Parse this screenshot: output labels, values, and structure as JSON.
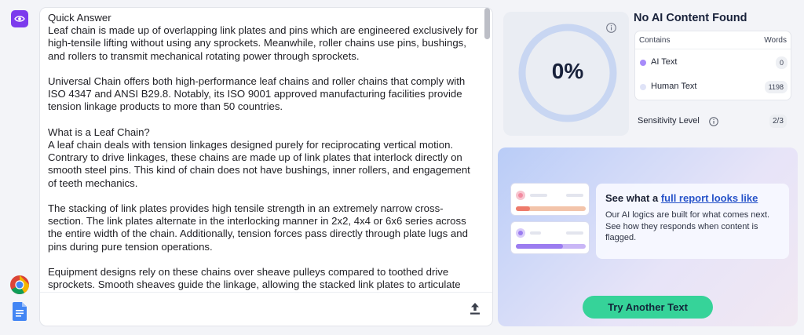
{
  "colors": {
    "accent_purple": "#7c3aed",
    "ring_blue": "#c8d6f2",
    "button_green": "#36d399",
    "ai_dot": "#a78bfa",
    "human_dot": "#dfe3f7",
    "link_blue": "#2753c9"
  },
  "rail": {
    "icons": [
      "eye-icon",
      "chrome-icon",
      "google-docs-icon"
    ]
  },
  "editor": {
    "paragraphs": [
      "Quick Answer\nLeaf chain is made up of overlapping link plates and pins which are engineered exclusively for high-tensile lifting without using any sprockets. Meanwhile, roller chains use pins, bushings, and rollers to transmit mechanical rotating power through sprockets.",
      "Universal Chain offers both high-performance leaf chains and roller chains that comply with ISO 4347 and ANSI B29.8. Notably, its ISO 9001 approved manufacturing facilities provide tension linkage products to more than 50 countries.",
      "What is a Leaf Chain?\nA leaf chain deals with tension linkages designed purely for reciprocating vertical motion. Contrary to drive linkages, these chains are made up of link plates that interlock directly on smooth steel pins. This kind of chain does not have bushings, inner rollers, and engagement of teeth mechanics.",
      "The stacking of link plates provides high tensile strength in an extremely narrow cross-section. The link plates alternate in the interlocking manner in 2x2, 4x4 or 6x6 series across the entire width of the chain. Additionally, tension forces pass directly through plate lugs and pins during pure tension operations.",
      "Equipment designs rely on these chains over sheave pulleys compared to toothed drive sprockets. Smooth sheaves guide the linkage, allowing the stacked link plates to articulate"
    ],
    "upload_icon": "upload-icon"
  },
  "score": {
    "percent_label": "0%",
    "percent_value": 0,
    "info_icon": "info-icon"
  },
  "result": {
    "title": "No AI Content Found",
    "col_contains": "Contains",
    "col_words": "Words",
    "rows": [
      {
        "label": "AI Text",
        "count": "0"
      },
      {
        "label": "Human Text",
        "count": "1198"
      }
    ],
    "sensitivity_label": "Sensitivity Level",
    "sensitivity_value": "2/3"
  },
  "promo": {
    "heading_prefix": "See what a ",
    "heading_link": "full report looks like",
    "body": "Our AI logics are built for what comes next. See how they responds when content is flagged.",
    "button_label": "Try Another Text"
  }
}
